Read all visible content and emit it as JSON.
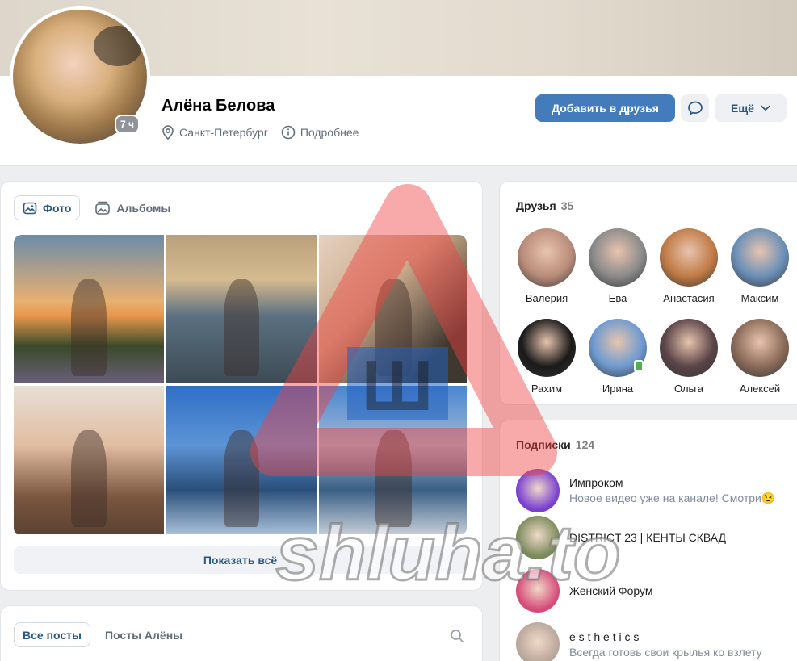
{
  "profile": {
    "name": "Алёна Белова",
    "online_badge": "7 ч",
    "city": "Санкт-Петербург",
    "more_info": "Подробнее",
    "add_friend": "Добавить в друзья",
    "more_button": "Ещё"
  },
  "photos": {
    "tabs": [
      "Фото",
      "Альбомы"
    ],
    "show_all": "Показать всё"
  },
  "posts": {
    "tabs": [
      "Все посты",
      "Посты Алёны"
    ]
  },
  "friends": {
    "title": "Друзья",
    "count": "35",
    "items": [
      {
        "name": "Валерия",
        "color": "#b98c7a"
      },
      {
        "name": "Ева",
        "color": "#8a8a8a"
      },
      {
        "name": "Анастасия",
        "color": "#c07a45"
      },
      {
        "name": "Максим",
        "color": "#6a8fb8"
      },
      {
        "name": "Рахим",
        "color": "#1a1a1a"
      },
      {
        "name": "Ирина",
        "color": "#6d9ad1"
      },
      {
        "name": "Ольга",
        "color": "#5a4448"
      },
      {
        "name": "Алексей",
        "color": "#8a6a58"
      }
    ]
  },
  "subscriptions": {
    "title": "Подписки",
    "count": "124",
    "items": [
      {
        "name": "Импроком",
        "desc": "Новое видео уже на канале! Смотри😉",
        "color": "#7a3fd1"
      },
      {
        "name": "DISTRICT 23 | КЕНТЫ СКВАД",
        "desc": "",
        "color": "#7a8a5a"
      },
      {
        "name": "Женский Форум",
        "desc": "",
        "color": "#d64a7a"
      },
      {
        "name": "e s t h e t i c s",
        "desc": "Всегда готовь свои крылья ко взлету",
        "color": "#b9a69a"
      }
    ]
  },
  "watermark": {
    "letter": "Ш",
    "text": "shluha.to"
  }
}
